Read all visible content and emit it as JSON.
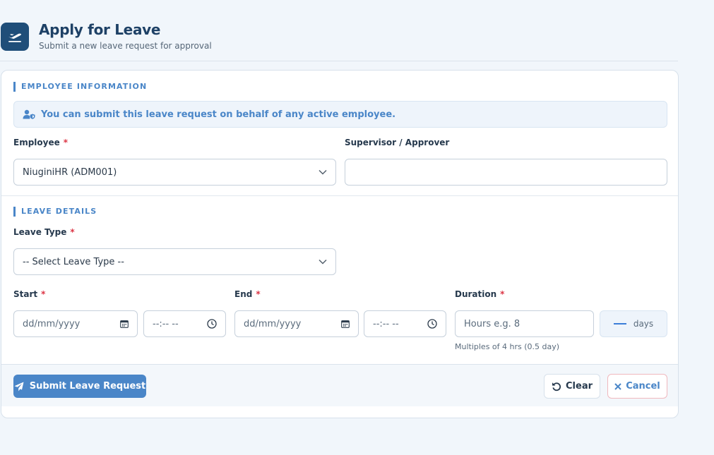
{
  "header": {
    "title": "Apply for Leave",
    "subtitle": "Submit a new leave request for approval",
    "icon": "plane-departure-icon"
  },
  "employee_section": {
    "title": "EMPLOYEE INFORMATION",
    "info": "You can submit this leave request on behalf of any active employee.",
    "info_icon": "user-shield-icon",
    "employee_label": "Employee",
    "employee_value": "NiuginiHR (ADM001)",
    "supervisor_label": "Supervisor / Approver",
    "supervisor_value": ""
  },
  "leave_section": {
    "title": "LEAVE DETAILS",
    "leave_type_label": "Leave Type",
    "leave_type_value": "-- Select Leave Type --",
    "start_label": "Start",
    "end_label": "End",
    "duration_label": "Duration",
    "date_placeholder": "dd/mm/yyyy",
    "time_placeholder": "--:-- --",
    "hours_placeholder": "Hours e.g. 8",
    "days_unit": "days",
    "duration_hint": "Multiples of 4 hrs (0.5 day)"
  },
  "required_mark": "*",
  "footer": {
    "submit": "Submit Leave Request",
    "clear": "Clear",
    "cancel": "Cancel"
  },
  "colors": {
    "accent": "#4a86c8",
    "header_icon_bg": "#1f4e79",
    "required": "#dc3545"
  }
}
